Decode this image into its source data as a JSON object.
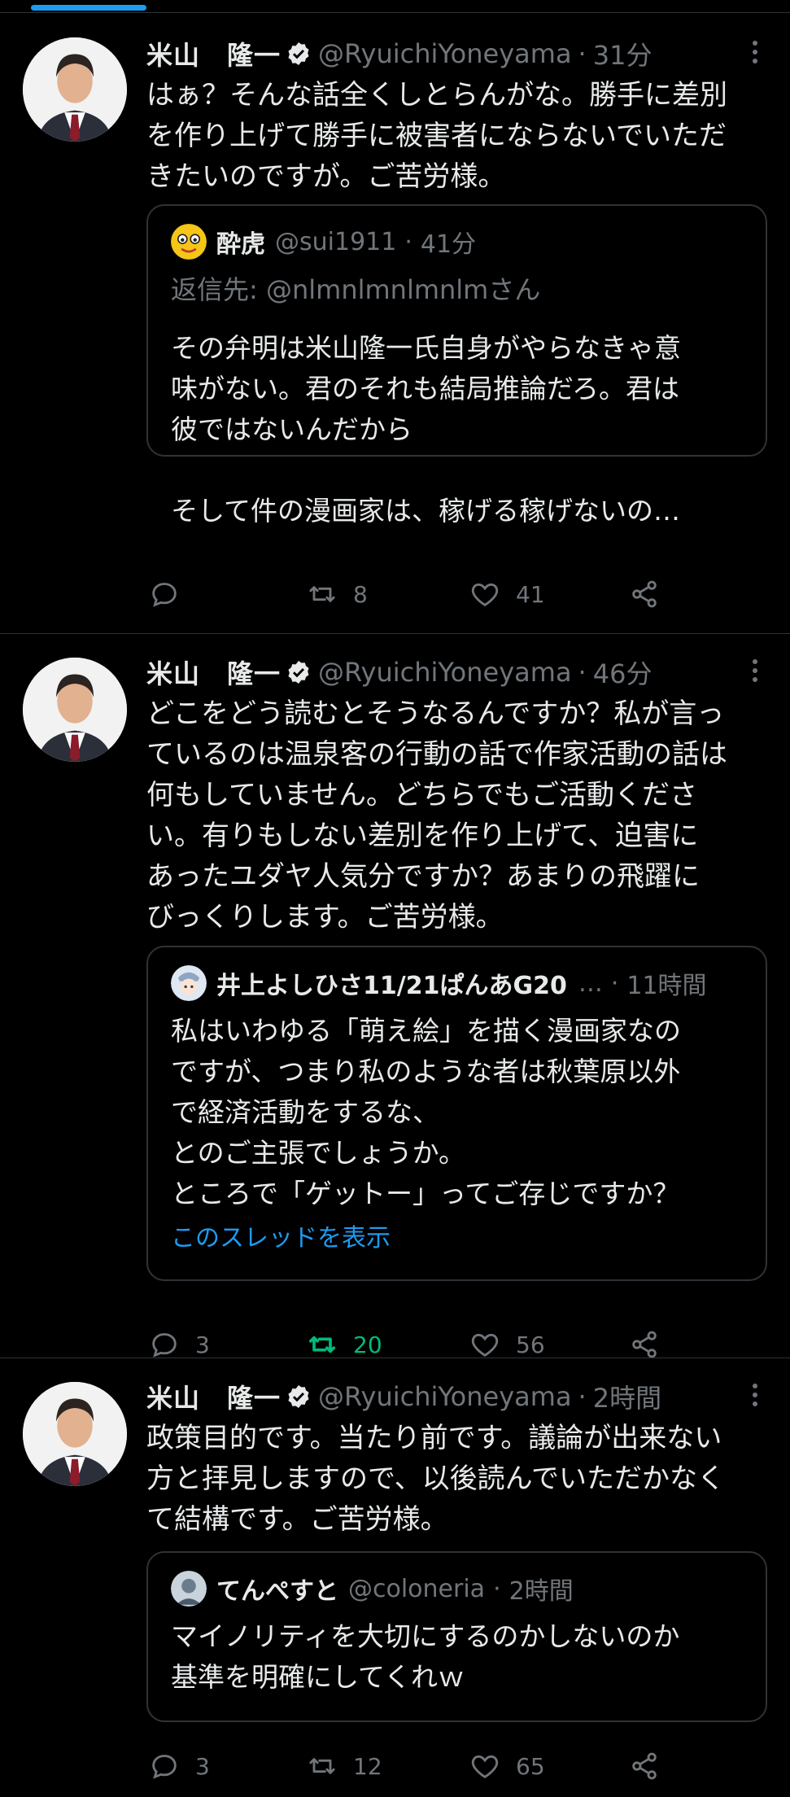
{
  "tweets": [
    {
      "author_name": "米山　隆一",
      "handle": "@RyuichiYoneyama",
      "time": "31分",
      "text": "はぁ？そんな話全くしとらんがな。勝手に差別\nを作り上げて勝手に被害者にならないでいただ\nきたいのですが。ご苦労様。",
      "quote": {
        "name": "酔虎",
        "handle": "@sui1911",
        "time": "41分",
        "reply_prefix": "返信先: ",
        "reply_to": "@nlmnlmnlmnlm",
        "reply_suffix": "さん",
        "text": "その弁明は米山隆一氏自身がやらなきゃ意\n味がない。君のそれも結局推論だろ。君は\n彼ではないんだから\n\nそして件の漫画家は、稼げる稼げないの…"
      },
      "counts": {
        "reply": "",
        "retweet": "8",
        "like": "41"
      }
    },
    {
      "author_name": "米山　隆一",
      "handle": "@RyuichiYoneyama",
      "time": "46分",
      "text": "どこをどう読むとそうなるんですか？私が言っ\nているのは温泉客の行動の話で作家活動の話は\n何もしていません。どちらでもご活動くださ\nい。有りもしない差別を作り上げて、迫害に\nあったユダヤ人気分ですか？あまりの飛躍に\nびっくりします。ご苦労様。",
      "quote": {
        "name": "井上よしひさ11/21ぱんあG20",
        "handle_ellipsis": "…",
        "time": "11時間",
        "text": "私はいわゆる「萌え絵」を描く漫画家なの\nですが、つまり私のような者は秋葉原以外\nで経済活動をするな、\nとのご主張でしょうか。\nところで「ゲットー」ってご存じですか？",
        "show_thread": "このスレッドを表示"
      },
      "counts": {
        "reply": "3",
        "retweet": "20",
        "like": "56"
      },
      "retweeted": true
    },
    {
      "author_name": "米山　隆一",
      "handle": "@RyuichiYoneyama",
      "time": "2時間",
      "text": "政策目的です。当たり前です。議論が出来ない\n方と拝見しますので、以後読んでいただかなく\nて結構です。ご苦労様。",
      "quote": {
        "name": "てんぺすと",
        "handle": "@coloneria",
        "time": "2時間",
        "text": "マイノリティを大切にするのかしないのか\n基準を明確にしてくれｗ"
      },
      "counts": {
        "reply": "3",
        "retweet": "12",
        "like": "65"
      }
    }
  ],
  "dot": "·",
  "colors": {
    "accent": "#1d9bf0",
    "retweet_active": "#00ba7c",
    "muted": "#71767b"
  }
}
